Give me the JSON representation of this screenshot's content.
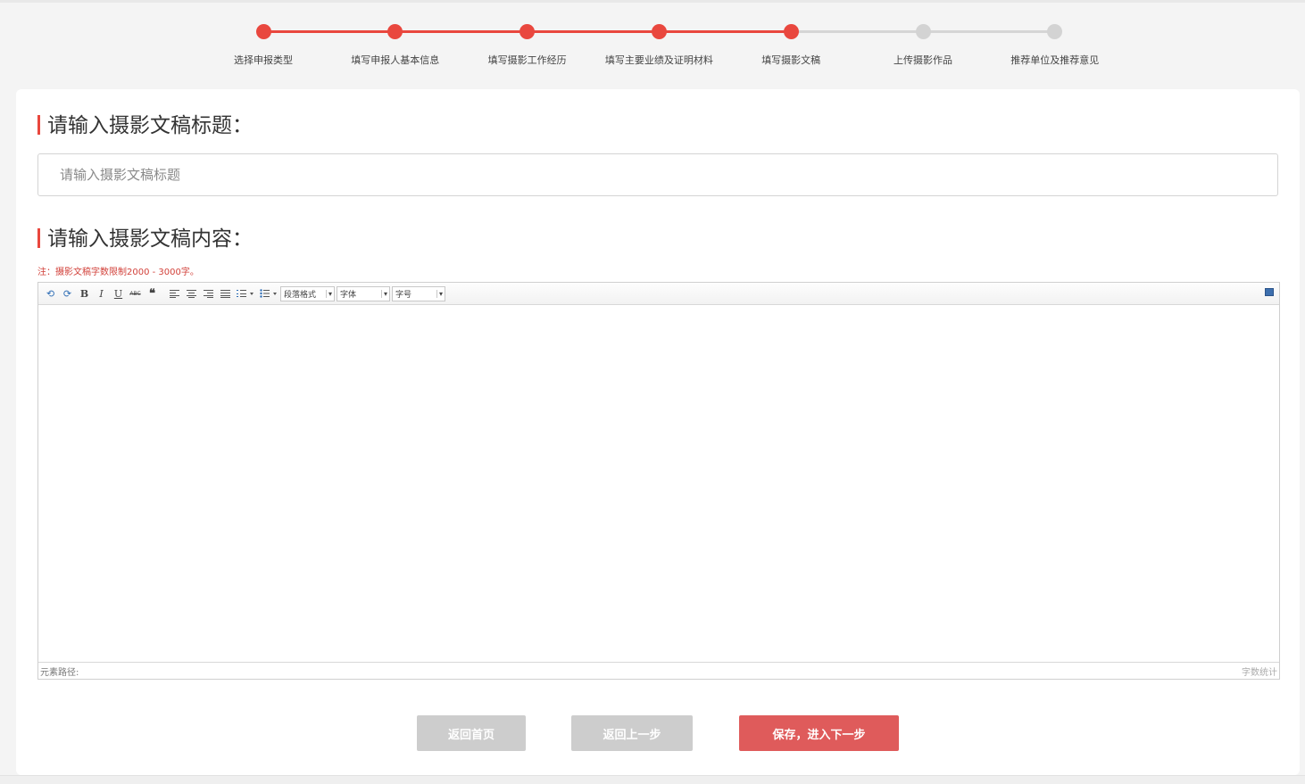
{
  "stepper": {
    "steps": [
      {
        "label": "选择申报类型",
        "status": "done"
      },
      {
        "label": "填写申报人基本信息",
        "status": "done"
      },
      {
        "label": "填写摄影工作经历",
        "status": "done"
      },
      {
        "label": "填写主要业绩及证明材料",
        "status": "done"
      },
      {
        "label": "填写摄影文稿",
        "status": "done"
      },
      {
        "label": "上传摄影作品",
        "status": "todo"
      },
      {
        "label": "推荐单位及推荐意见",
        "status": "todo"
      }
    ],
    "colors": {
      "done": "#e9473e",
      "todo": "#d3d3d3"
    }
  },
  "form": {
    "title_heading": "请输入摄影文稿标题：",
    "title_placeholder": "请输入摄影文稿标题",
    "title_value": "",
    "content_heading": "请输入摄影文稿内容：",
    "note": "注：摄影文稿字数限制2000 - 3000字。"
  },
  "editor": {
    "toolbar": {
      "undo": "⟲",
      "redo": "⟳",
      "bold": "B",
      "italic": "I",
      "underline": "U",
      "strike": "ABC",
      "quote": "❝",
      "paragraph_select": "段落格式",
      "font_select": "字体",
      "size_select": "字号"
    },
    "status_left": "元素路径:",
    "status_right": "字数统计"
  },
  "buttons": {
    "home": "返回首页",
    "back": "返回上一步",
    "next": "保存，进入下一步"
  }
}
